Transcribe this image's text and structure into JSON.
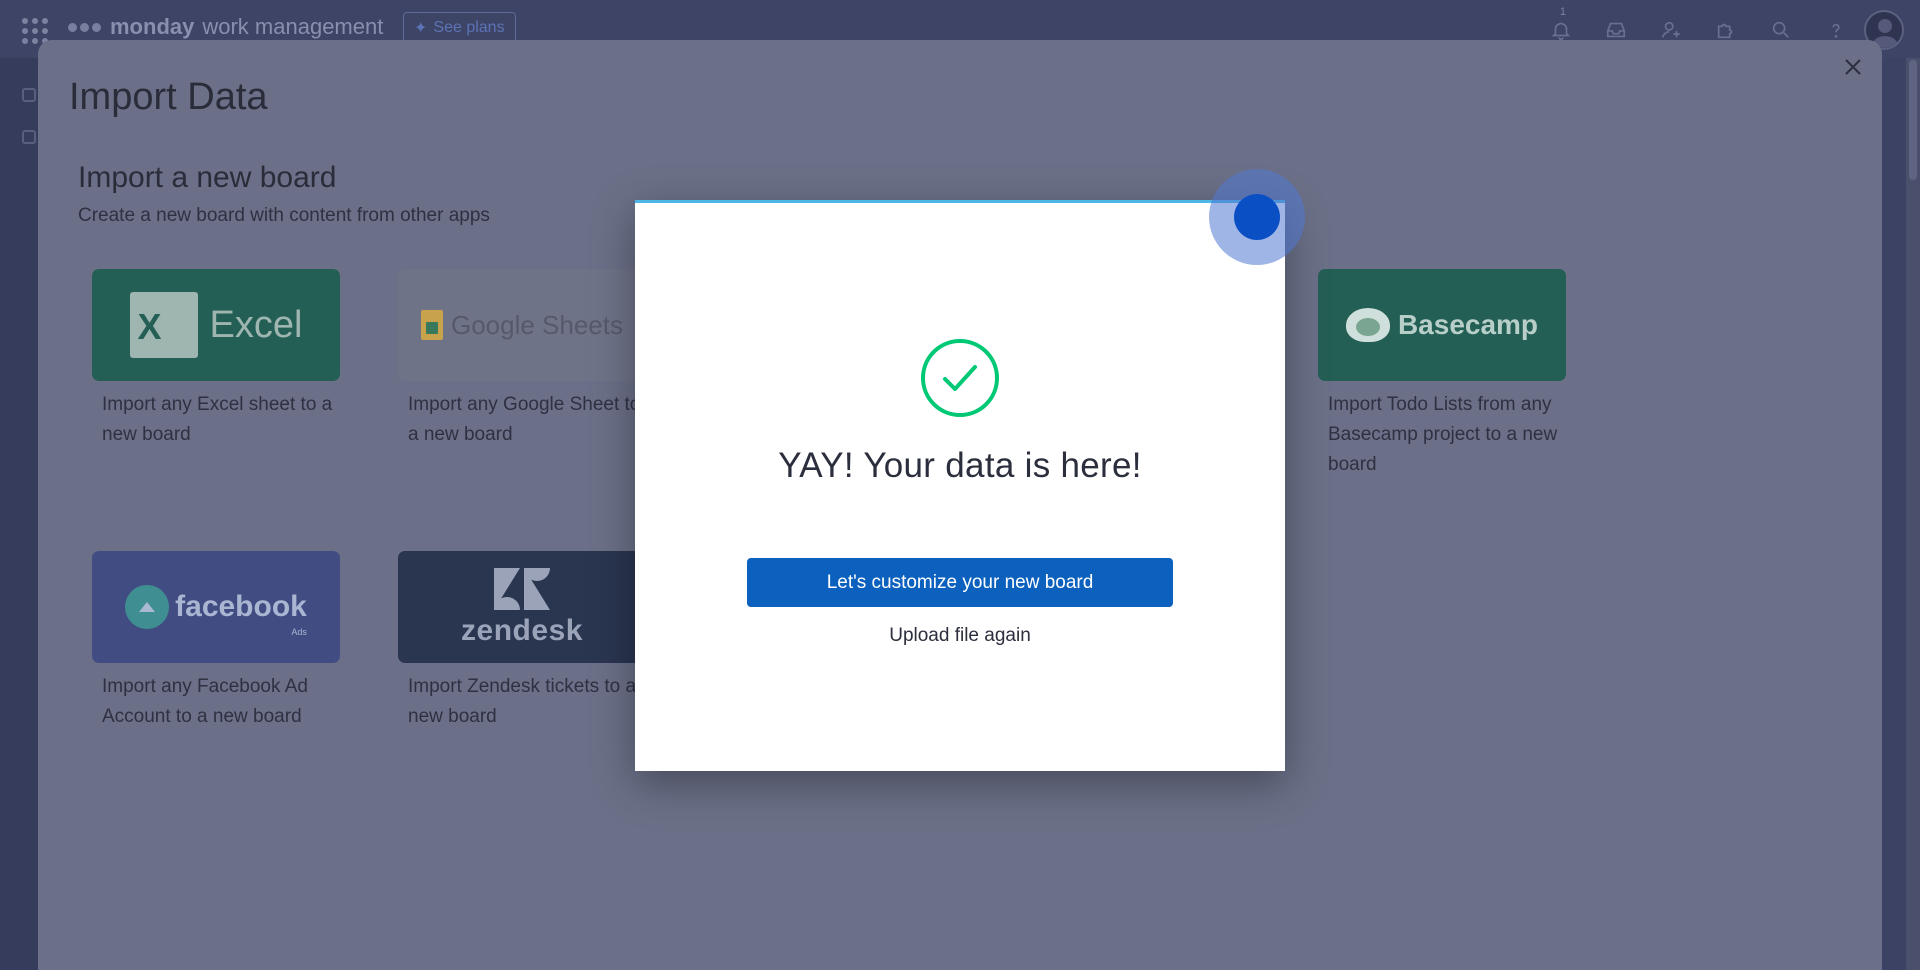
{
  "topbar": {
    "brand_name": "monday",
    "brand_sub": "work management",
    "see_plans_label": "See plans",
    "inbox_badge": "1",
    "icons": [
      "bell-icon",
      "inbox-icon",
      "invite-icon",
      "puzzle-icon",
      "search-icon",
      "help-icon"
    ]
  },
  "import_panel": {
    "title": "Import Data",
    "section_title": "Import a new board",
    "section_subtitle": "Create a new board with content from other apps",
    "cards": [
      {
        "id": "excel",
        "logo_text": "Excel",
        "description": "Import any Excel sheet to a new board"
      },
      {
        "id": "google-sheets",
        "logo_text": "Google Sheets",
        "description": "Import any Google Sheet to a new board"
      },
      {
        "id": "basecamp",
        "logo_text": "Basecamp",
        "description": "Import Todo Lists from any Basecamp project to a new board"
      },
      {
        "id": "facebook",
        "logo_text": "facebook",
        "logo_sub": "Ads",
        "description": "Import any Facebook Ad Account to a new board"
      },
      {
        "id": "zendesk",
        "logo_text": "zendesk",
        "description": "Import Zendesk tickets to a new board"
      }
    ]
  },
  "success_modal": {
    "title": "YAY! Your data is here!",
    "primary_button": "Let's customize your new board",
    "secondary_link": "Upload file again"
  },
  "colors": {
    "primary_button": "#0b61bd",
    "success_check": "#00c875",
    "modal_accent_line": "#4fb7e5",
    "overlay_panel": "#6b7088"
  }
}
